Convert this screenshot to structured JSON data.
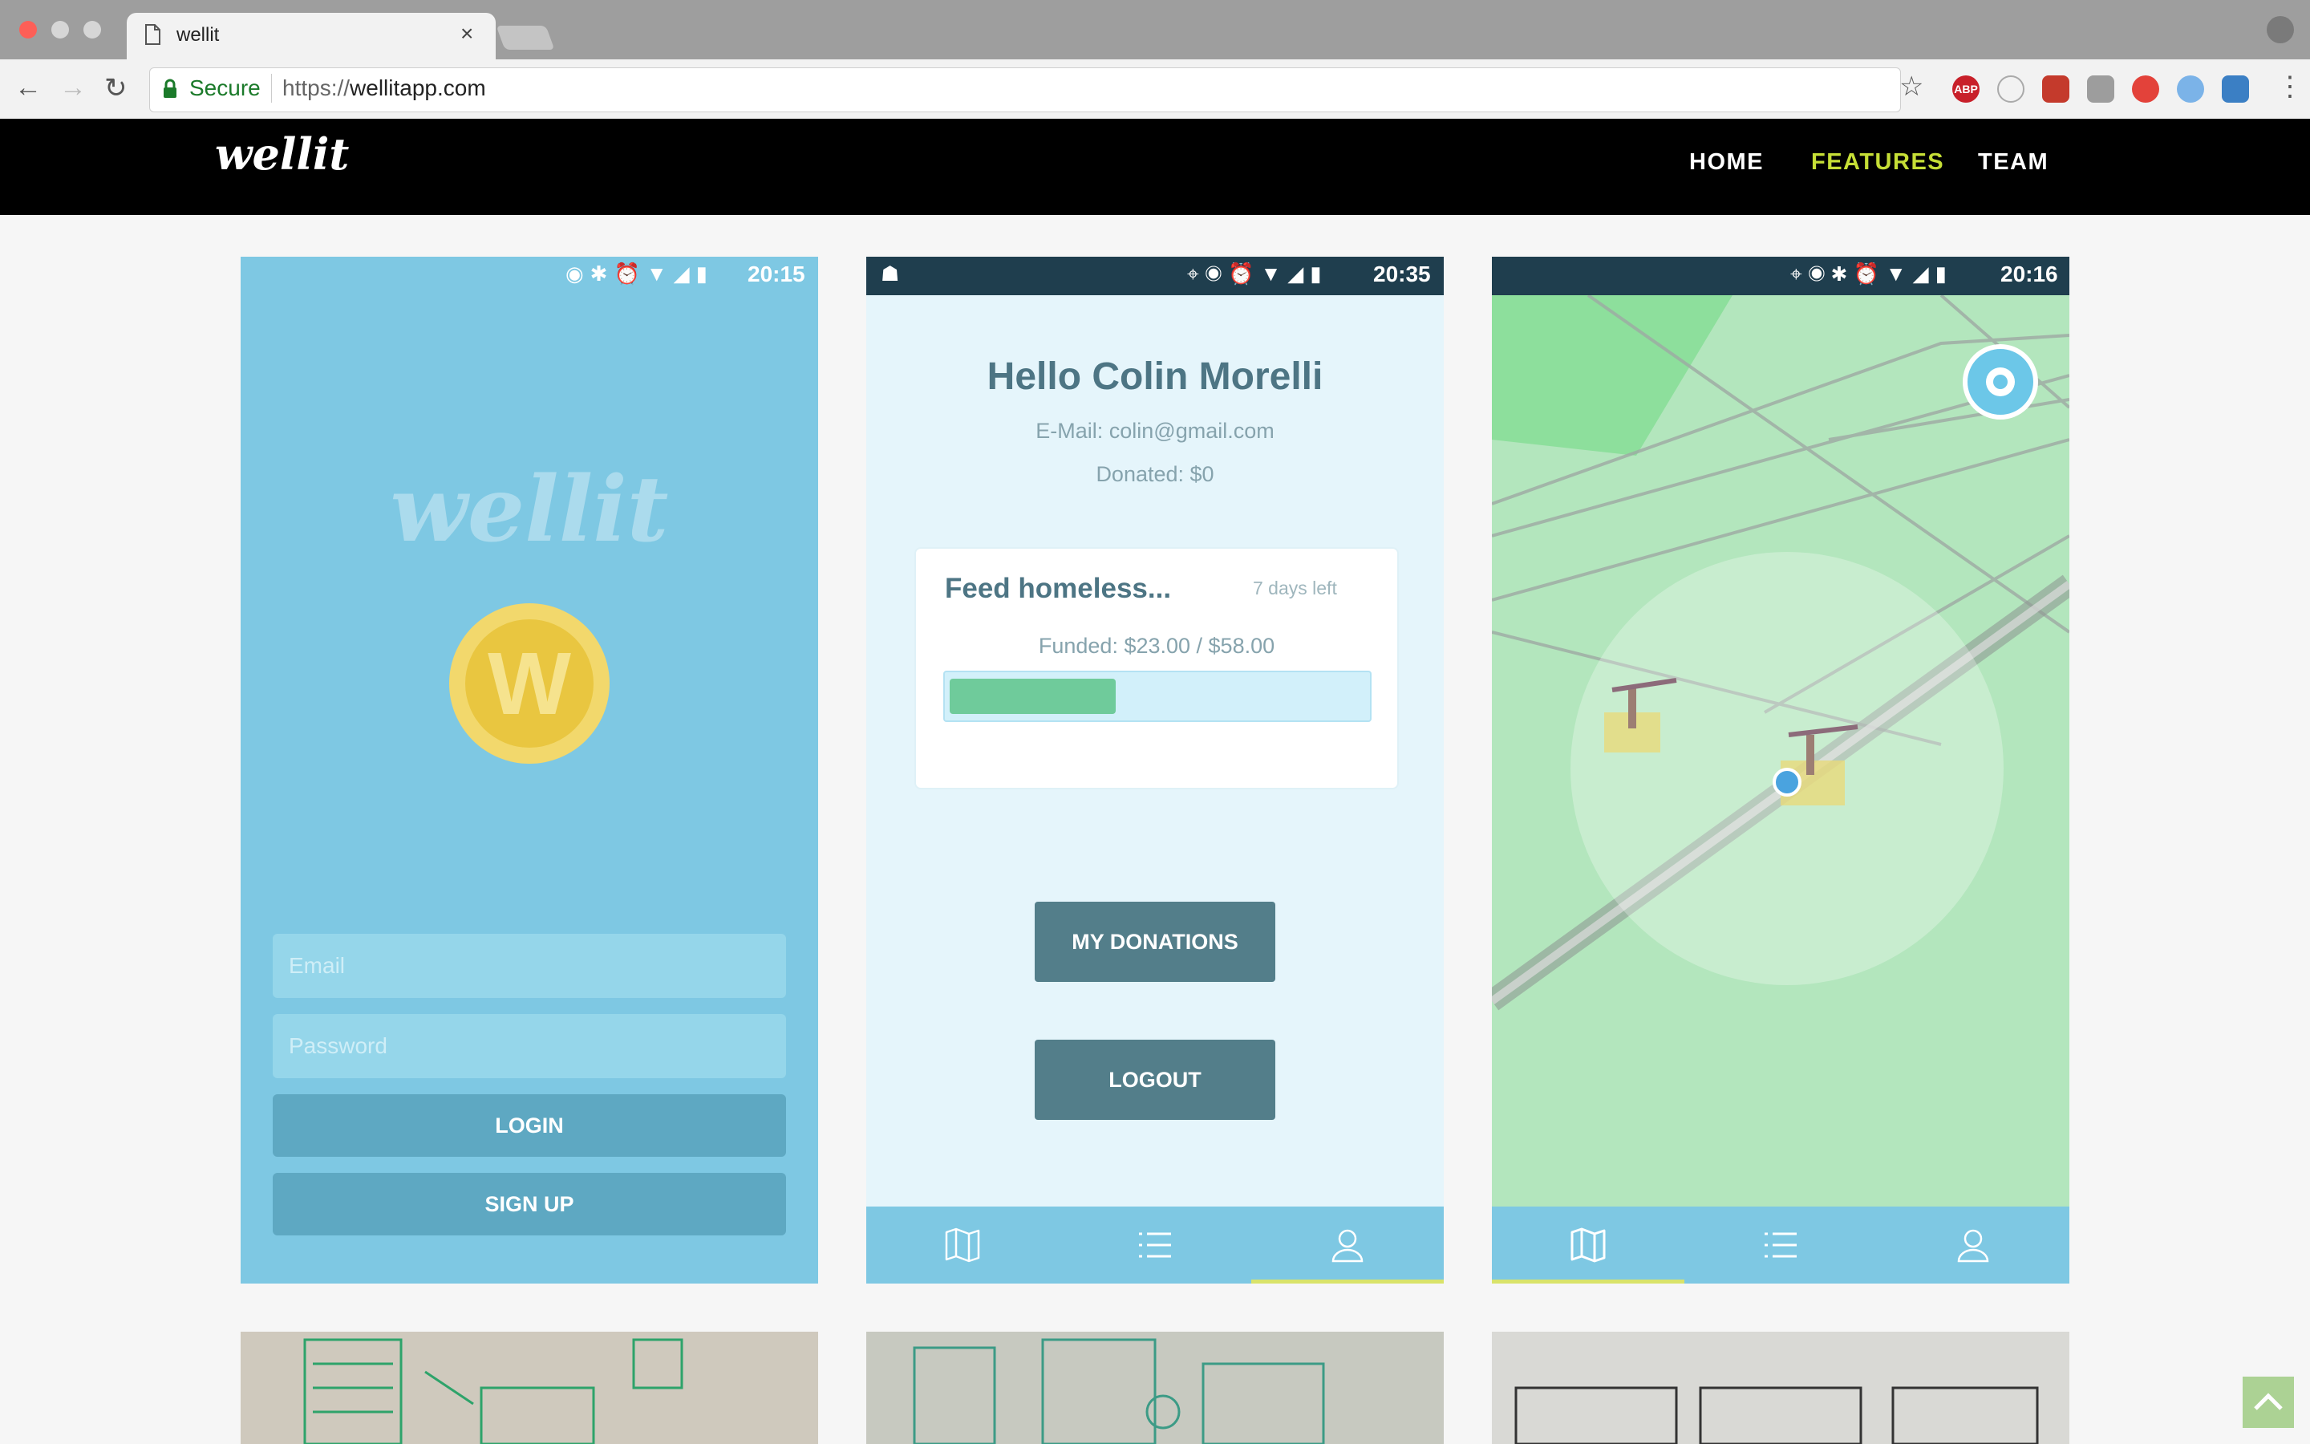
{
  "browser": {
    "tab_title": "wellit",
    "tab_close": "×",
    "secure_label": "Secure",
    "url_scheme": "https://",
    "url_host": "wellitapp.com",
    "extensions": [
      "abp-icon",
      "ghostery-icon",
      "lastpass-icon",
      "settings-ext-icon",
      "record-ext-icon",
      "pencil-ext-icon",
      "eyedropper-ext-icon"
    ]
  },
  "site": {
    "brand": "wellit",
    "nav": [
      {
        "label": "HOME",
        "active": false
      },
      {
        "label": "FEATURES",
        "active": true
      },
      {
        "label": "TEAM",
        "active": false
      }
    ]
  },
  "panel_login": {
    "time": "20:15",
    "logo": "wellit",
    "coin_letter": "W",
    "email_placeholder": "Email",
    "password_placeholder": "Password",
    "login_label": "LOGIN",
    "signup_label": "SIGN UP"
  },
  "panel_profile": {
    "time": "20:35",
    "greeting": "Hello Colin Morelli",
    "email_line": "E-Mail: colin@gmail.com",
    "donated_line": "Donated: $0",
    "campaign": {
      "title": "Feed homeless...",
      "days_left": "7 days left",
      "funded_text": "Funded: $23.00 / $58.00",
      "progress_fraction": 0.4
    },
    "my_donations_label": "MY DONATIONS",
    "logout_label": "LOGOUT",
    "active_tab": "profile"
  },
  "panel_map": {
    "time": "20:16",
    "active_tab": "map"
  },
  "colors": {
    "nav_active": "#c6df36",
    "login_bg": "#7ec8e3",
    "status_bar": "#1f3e4e",
    "progress_fill": "#6fcb9b",
    "button_dark": "#537e8a",
    "map_bg": "#b3e6bd"
  },
  "back_to_top_icon": "chevron-up-icon"
}
